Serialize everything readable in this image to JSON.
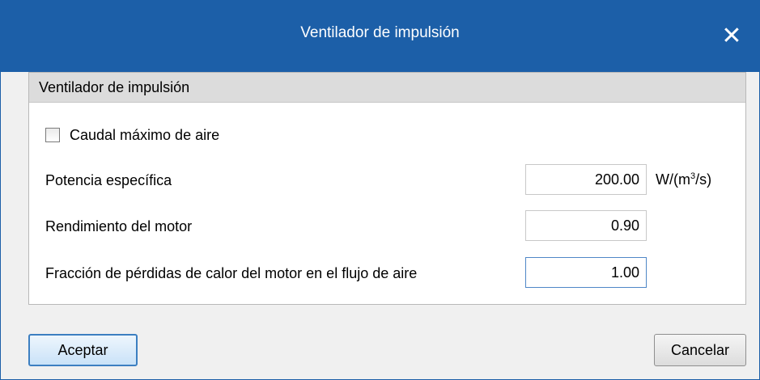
{
  "window": {
    "title": "Ventilador de impulsión",
    "close_glyph": "✕"
  },
  "group": {
    "title": "Ventilador de impulsión",
    "checkbox": {
      "label": "Caudal máximo de aire",
      "checked": false
    },
    "rows": [
      {
        "label": "Potencia específica",
        "value": "200.00",
        "unit_prefix": "W/(m",
        "unit_sup": "3",
        "unit_suffix": "/s)"
      },
      {
        "label": "Rendimiento del motor",
        "value": "0.90"
      },
      {
        "label": "Fracción de pérdidas de calor del motor en el flujo de aire",
        "value": "1.00"
      }
    ]
  },
  "buttons": {
    "accept": "Aceptar",
    "cancel": "Cancelar"
  },
  "colors": {
    "titlebar": "#1c5fa8",
    "dialog_bg": "#f0f0f0",
    "group_header": "#dcdcdc",
    "primary_border": "#3c7fc1"
  },
  "icons": {
    "close": "close-icon",
    "checkbox": "checkbox-icon"
  }
}
